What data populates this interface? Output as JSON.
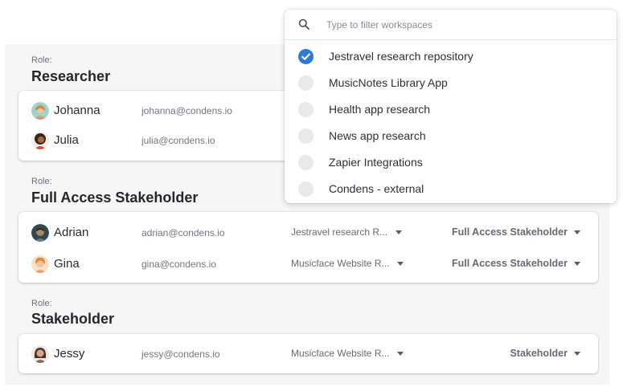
{
  "colors": {
    "accent": "#2f7ad8",
    "panel_bg": "#f6f6f7"
  },
  "groups": [
    {
      "role_label": "Role:",
      "role_name": "Researcher",
      "users": [
        {
          "name": "Johanna",
          "email": "johanna@condens.io",
          "avatar": "avatar-johanna"
        },
        {
          "name": "Julia",
          "email": "julia@condens.io",
          "avatar": "avatar-julia"
        }
      ]
    },
    {
      "role_label": "Role:",
      "role_name": "Full Access Stakeholder",
      "users": [
        {
          "name": "Adrian",
          "email": "adrian@condens.io",
          "workspace": "Jestravel research R...",
          "role": "Full Access Stakeholder",
          "avatar": "avatar-adrian"
        },
        {
          "name": "Gina",
          "email": "gina@condens.io",
          "workspace": "Musicface Website R...",
          "role": "Full Access Stakeholder",
          "avatar": "avatar-gina"
        }
      ]
    },
    {
      "role_label": "Role:",
      "role_name": "Stakeholder",
      "users": [
        {
          "name": "Jessy",
          "email": "jessy@condens.io",
          "workspace": "Musicface Website R...",
          "role": "Stakeholder",
          "avatar": "avatar-jessy"
        }
      ]
    }
  ],
  "dropdown": {
    "search_placeholder": "Type to filter workspaces",
    "search_icon": "search-icon",
    "items": [
      {
        "label": "Jestravel research repository",
        "checked": true
      },
      {
        "label": "MusicNotes Library App",
        "checked": false
      },
      {
        "label": "Health app research",
        "checked": false
      },
      {
        "label": "News app research",
        "checked": false
      },
      {
        "label": "Zapier Integrations",
        "checked": false
      },
      {
        "label": "Condens - external",
        "checked": false
      }
    ]
  }
}
